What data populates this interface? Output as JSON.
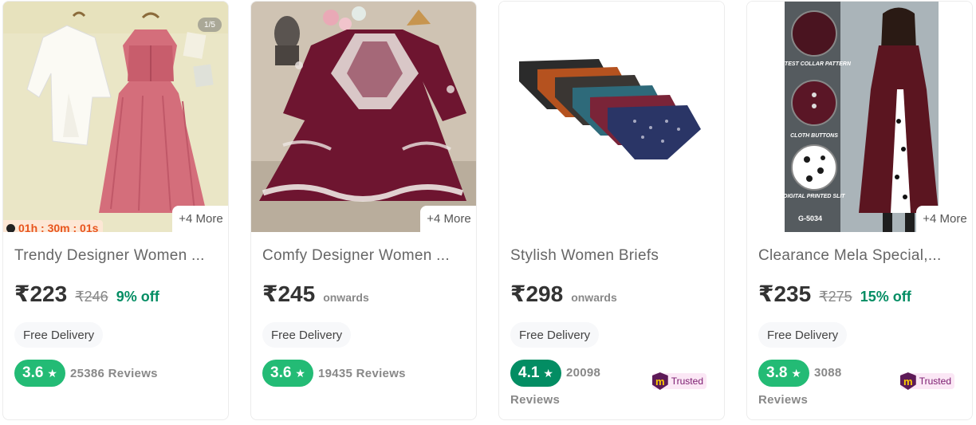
{
  "products": [
    {
      "title": "Trendy Designer Women ...",
      "price": "₹223",
      "mrp": "₹246",
      "discount": "9% off",
      "pager": "1/5",
      "timer": "01h : 30m : 01s",
      "more": "+4 More",
      "delivery": "Free Delivery",
      "rating": "3.6",
      "reviews": "25386 Reviews"
    },
    {
      "title": "Comfy Designer Women ...",
      "price": "₹245",
      "onwards": "onwards",
      "more": "+4 More",
      "delivery": "Free Delivery",
      "rating": "3.6",
      "reviews": "19435 Reviews"
    },
    {
      "title": "Stylish Women Briefs",
      "price": "₹298",
      "onwards": "onwards",
      "delivery": "Free Delivery",
      "rating": "4.1",
      "reviews_count": "20098",
      "reviews_label": "Reviews",
      "trusted": "Trusted"
    },
    {
      "title": "Clearance Mela Special,...",
      "price": "₹235",
      "mrp": "₹275",
      "discount": "15% off",
      "more": "+4 More",
      "delivery": "Free Delivery",
      "rating": "3.8",
      "reviews_count": "3088",
      "reviews_label": "Reviews",
      "trusted": "Trusted",
      "image_text": {
        "collar": "LATEST COLLAR PATTERN",
        "buttons": "CLOTH BUTTONS",
        "slit": "DIGITAL PRINTED SLIT",
        "code": "G-5034"
      }
    }
  ],
  "colors": {
    "discount_green": "#038d63",
    "rating_green": "#23bb75",
    "rating_dark_green": "#038d63",
    "timer_orange": "#e8551d",
    "trusted_purple": "#5d1a57"
  },
  "icons": [
    "star-icon",
    "timer-icon",
    "meesho-logo-icon"
  ]
}
